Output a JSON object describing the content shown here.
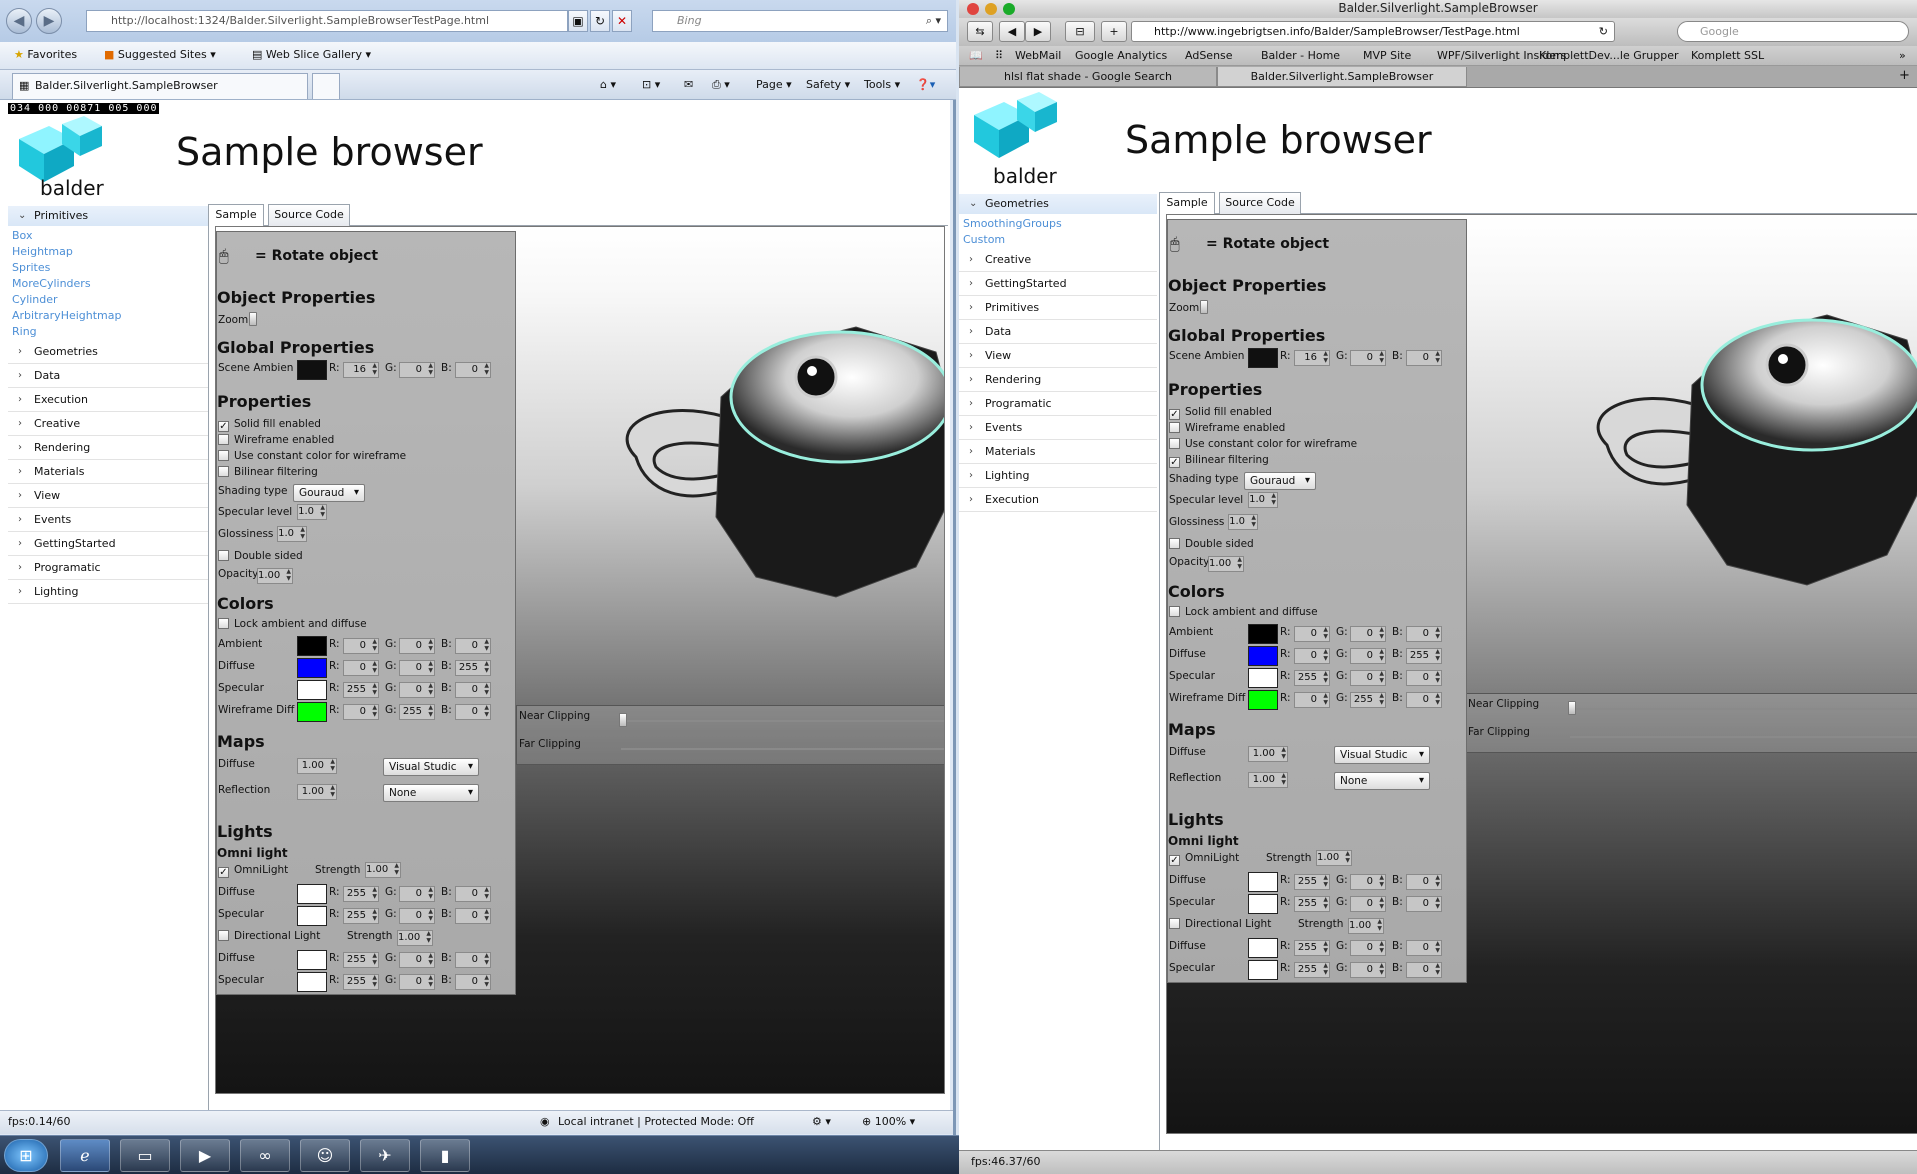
{
  "left": {
    "address": "http://localhost:1324/Balder.Silverlight.SampleBrowserTestPage.html",
    "search_placeholder": "Bing",
    "favorites": "Favorites",
    "suggested_sites": "Suggested Sites",
    "web_slice_gallery": "Web Slice Gallery",
    "tab_title": "Balder.Silverlight.SampleBrowser",
    "cmd_page": "Page",
    "cmd_safety": "Safety",
    "cmd_tools": "Tools",
    "counters": [
      "034",
      "000",
      "00871",
      "005",
      "000"
    ],
    "nav_expanded": "Primitives",
    "nav_children": [
      "Box",
      "Heightmap",
      "Sprites",
      "MoreCylinders",
      "Cylinder",
      "ArbitraryHeightmap",
      "Ring"
    ],
    "nav_items": [
      "Geometries",
      "Data",
      "Execution",
      "Creative",
      "Rendering",
      "Materials",
      "View",
      "Events",
      "GettingStarted",
      "Programatic",
      "Lighting"
    ],
    "fps": "fps:0.14/60",
    "zone": "Local intranet | Protected Mode: Off",
    "zoom": "100%"
  },
  "right": {
    "window_title": "Balder.Silverlight.SampleBrowser",
    "address": "http://www.ingebrigtsen.info/Balder/SampleBrowser/TestPage.html",
    "search_placeholder": "Google",
    "bookmarks": [
      "WebMail",
      "Google Analytics",
      "AdSense",
      "Balder - Home",
      "MVP Site",
      "WPF/Silverlight Insiders",
      "KomplettDev...le Grupper",
      "Komplett SSL"
    ],
    "tabs": [
      "hlsl flat shade - Google Search",
      "Balder.Silverlight.SampleBrowser"
    ],
    "nav_expanded": "Geometries",
    "nav_children": [
      "SmoothingGroups",
      "Custom"
    ],
    "nav_items": [
      "Creative",
      "GettingStarted",
      "Primitives",
      "Data",
      "View",
      "Rendering",
      "Programatic",
      "Events",
      "Materials",
      "Lighting",
      "Execution"
    ],
    "fps": "fps:46.37/60"
  },
  "app": {
    "logo_text": "balder",
    "title": "Sample browser",
    "tab_sample": "Sample",
    "tab_source": "Source Code",
    "rotate_label": "= Rotate object",
    "object_properties": "Object Properties",
    "zoom": "Zoom",
    "global_properties": "Global Properties",
    "scene_ambient": "Scene Ambien",
    "properties": "Properties",
    "solid_fill": "Solid fill enabled",
    "wireframe": "Wireframe enabled",
    "const_color": "Use constant color for wireframe",
    "bilinear": "Bilinear filtering",
    "shading_type": "Shading type",
    "shading_value": "Gouraud",
    "specular_level": "Specular level",
    "glossiness": "Glossiness",
    "double_sided": "Double sided",
    "opacity": "Opacity",
    "val_1_0": "1.0",
    "val_1_00": "1.00",
    "colors": "Colors",
    "lock_ambient": "Lock ambient and diffuse",
    "ambient": "Ambient",
    "diffuse": "Diffuse",
    "specular": "Specular",
    "wireframe_diff": "Wireframe Diff",
    "r": "R:",
    "g": "G:",
    "b": "B:",
    "maps": "Maps",
    "reflection": "Reflection",
    "map_diffuse_value": "Visual Studic",
    "map_reflection_value": "None",
    "lights": "Lights",
    "omni_light_h": "Omni light",
    "omni_light": "OmniLight",
    "strength": "Strength",
    "directional": "Directional Light",
    "near_clipping": "Near Clipping",
    "far_clipping": "Far Clipping",
    "v0": "0",
    "v16": "16",
    "v255": "255",
    "colors_map": {
      "ambient": "#000000",
      "diffuse": "#0000ff",
      "specular": "#ffffff",
      "wireframe": "#00ff00",
      "scene": "#101010"
    }
  }
}
